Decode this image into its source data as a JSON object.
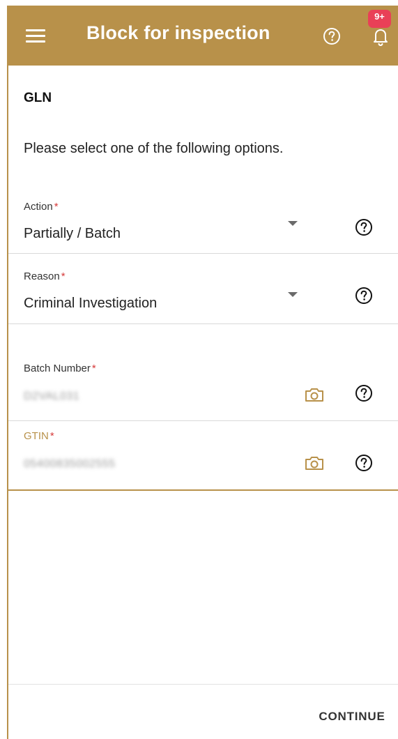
{
  "header": {
    "title": "Block for inspection",
    "notification_badge": "9+",
    "bar_color": "#b8914a",
    "badge_color": "#e94057",
    "icons": [
      "menu-icon",
      "help-icon",
      "bell-icon"
    ]
  },
  "content": {
    "section_title": "GLN",
    "instruction": "Please select one of the following options."
  },
  "fields": {
    "action": {
      "label": "Action",
      "required_mark": "*",
      "value": "Partially / Batch"
    },
    "reason": {
      "label": "Reason",
      "required_mark": "*",
      "value": "Criminal Investigation"
    },
    "batch_number": {
      "label": "Batch Number",
      "required_mark": "*",
      "value": "D2VAL031"
    },
    "gtin": {
      "label": "GTIN",
      "required_mark": "*",
      "value": "05400835002555",
      "label_color": "#b8914a"
    }
  },
  "footer": {
    "continue_label": "CONTINUE"
  },
  "colors": {
    "accent": "#b8914a",
    "required": "#d63a3a"
  }
}
